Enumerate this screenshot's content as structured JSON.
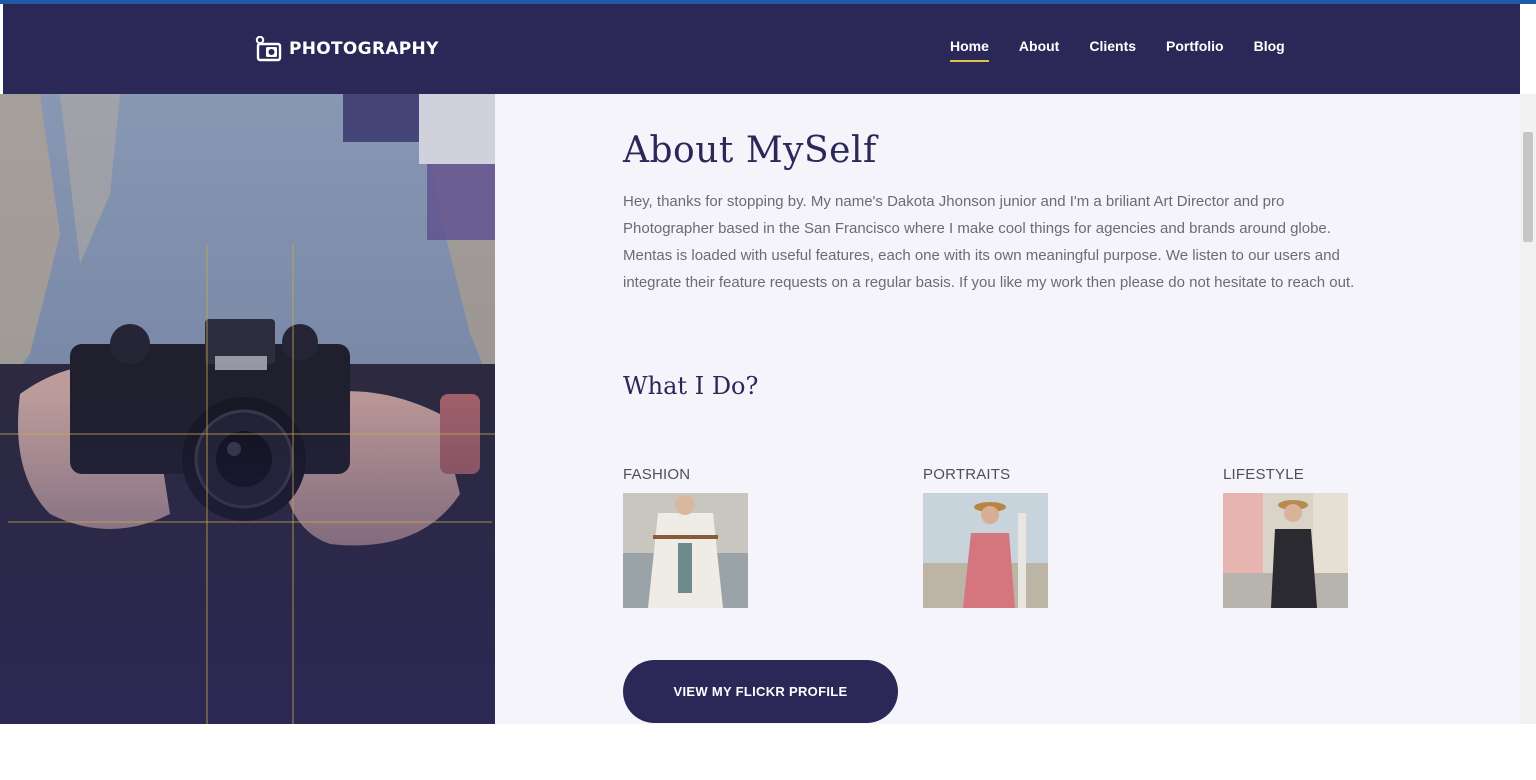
{
  "header": {
    "logo_text": "PHOTOGRAPHY",
    "logo_icon": "camera-icon",
    "nav": [
      {
        "label": "Home",
        "active": true
      },
      {
        "label": "About",
        "active": false
      },
      {
        "label": "Clients",
        "active": false
      },
      {
        "label": "Portfolio",
        "active": false
      },
      {
        "label": "Blog",
        "active": false
      }
    ]
  },
  "about": {
    "title": "About MySelf",
    "text": "Hey, thanks for stopping by. My name's Dakota Jhonson junior and I'm a briliant Art Director and pro Photographer based in the San Francisco where I make cool things for agencies and brands around globe. Mentas is loaded with useful features, each one with its own meaningful purpose. We listen to our users and integrate their feature requests on a regular basis. If you like my work then please do not hesitate to reach out."
  },
  "what_i_do": {
    "title": "What I Do?",
    "services": [
      {
        "label": "FASHION"
      },
      {
        "label": "PORTRAITS"
      },
      {
        "label": "LIFESTYLE"
      }
    ]
  },
  "cta": {
    "label": "VIEW MY FLICKR PROFILE"
  },
  "colors": {
    "brand": "#2b2858",
    "accent": "#e0c24a",
    "background": "#f5f4fa",
    "top_line": "#1f5aa6"
  }
}
